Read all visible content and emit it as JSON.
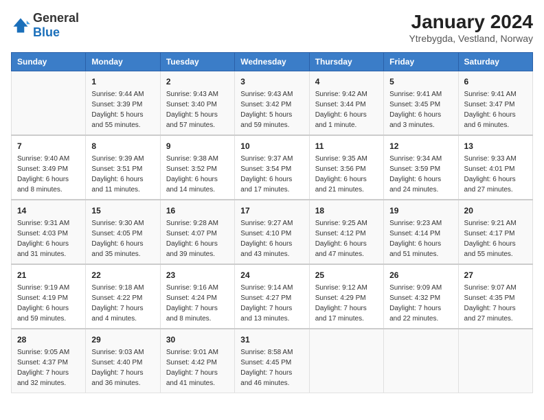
{
  "logo": {
    "general": "General",
    "blue": "Blue"
  },
  "title": "January 2024",
  "subtitle": "Ytrebygda, Vestland, Norway",
  "days_header": [
    "Sunday",
    "Monday",
    "Tuesday",
    "Wednesday",
    "Thursday",
    "Friday",
    "Saturday"
  ],
  "weeks": [
    [
      {
        "num": "",
        "sunrise": "",
        "sunset": "",
        "daylight": ""
      },
      {
        "num": "1",
        "sunrise": "Sunrise: 9:44 AM",
        "sunset": "Sunset: 3:39 PM",
        "daylight": "Daylight: 5 hours and 55 minutes."
      },
      {
        "num": "2",
        "sunrise": "Sunrise: 9:43 AM",
        "sunset": "Sunset: 3:40 PM",
        "daylight": "Daylight: 5 hours and 57 minutes."
      },
      {
        "num": "3",
        "sunrise": "Sunrise: 9:43 AM",
        "sunset": "Sunset: 3:42 PM",
        "daylight": "Daylight: 5 hours and 59 minutes."
      },
      {
        "num": "4",
        "sunrise": "Sunrise: 9:42 AM",
        "sunset": "Sunset: 3:44 PM",
        "daylight": "Daylight: 6 hours and 1 minute."
      },
      {
        "num": "5",
        "sunrise": "Sunrise: 9:41 AM",
        "sunset": "Sunset: 3:45 PM",
        "daylight": "Daylight: 6 hours and 3 minutes."
      },
      {
        "num": "6",
        "sunrise": "Sunrise: 9:41 AM",
        "sunset": "Sunset: 3:47 PM",
        "daylight": "Daylight: 6 hours and 6 minutes."
      }
    ],
    [
      {
        "num": "7",
        "sunrise": "Sunrise: 9:40 AM",
        "sunset": "Sunset: 3:49 PM",
        "daylight": "Daylight: 6 hours and 8 minutes."
      },
      {
        "num": "8",
        "sunrise": "Sunrise: 9:39 AM",
        "sunset": "Sunset: 3:51 PM",
        "daylight": "Daylight: 6 hours and 11 minutes."
      },
      {
        "num": "9",
        "sunrise": "Sunrise: 9:38 AM",
        "sunset": "Sunset: 3:52 PM",
        "daylight": "Daylight: 6 hours and 14 minutes."
      },
      {
        "num": "10",
        "sunrise": "Sunrise: 9:37 AM",
        "sunset": "Sunset: 3:54 PM",
        "daylight": "Daylight: 6 hours and 17 minutes."
      },
      {
        "num": "11",
        "sunrise": "Sunrise: 9:35 AM",
        "sunset": "Sunset: 3:56 PM",
        "daylight": "Daylight: 6 hours and 21 minutes."
      },
      {
        "num": "12",
        "sunrise": "Sunrise: 9:34 AM",
        "sunset": "Sunset: 3:59 PM",
        "daylight": "Daylight: 6 hours and 24 minutes."
      },
      {
        "num": "13",
        "sunrise": "Sunrise: 9:33 AM",
        "sunset": "Sunset: 4:01 PM",
        "daylight": "Daylight: 6 hours and 27 minutes."
      }
    ],
    [
      {
        "num": "14",
        "sunrise": "Sunrise: 9:31 AM",
        "sunset": "Sunset: 4:03 PM",
        "daylight": "Daylight: 6 hours and 31 minutes."
      },
      {
        "num": "15",
        "sunrise": "Sunrise: 9:30 AM",
        "sunset": "Sunset: 4:05 PM",
        "daylight": "Daylight: 6 hours and 35 minutes."
      },
      {
        "num": "16",
        "sunrise": "Sunrise: 9:28 AM",
        "sunset": "Sunset: 4:07 PM",
        "daylight": "Daylight: 6 hours and 39 minutes."
      },
      {
        "num": "17",
        "sunrise": "Sunrise: 9:27 AM",
        "sunset": "Sunset: 4:10 PM",
        "daylight": "Daylight: 6 hours and 43 minutes."
      },
      {
        "num": "18",
        "sunrise": "Sunrise: 9:25 AM",
        "sunset": "Sunset: 4:12 PM",
        "daylight": "Daylight: 6 hours and 47 minutes."
      },
      {
        "num": "19",
        "sunrise": "Sunrise: 9:23 AM",
        "sunset": "Sunset: 4:14 PM",
        "daylight": "Daylight: 6 hours and 51 minutes."
      },
      {
        "num": "20",
        "sunrise": "Sunrise: 9:21 AM",
        "sunset": "Sunset: 4:17 PM",
        "daylight": "Daylight: 6 hours and 55 minutes."
      }
    ],
    [
      {
        "num": "21",
        "sunrise": "Sunrise: 9:19 AM",
        "sunset": "Sunset: 4:19 PM",
        "daylight": "Daylight: 6 hours and 59 minutes."
      },
      {
        "num": "22",
        "sunrise": "Sunrise: 9:18 AM",
        "sunset": "Sunset: 4:22 PM",
        "daylight": "Daylight: 7 hours and 4 minutes."
      },
      {
        "num": "23",
        "sunrise": "Sunrise: 9:16 AM",
        "sunset": "Sunset: 4:24 PM",
        "daylight": "Daylight: 7 hours and 8 minutes."
      },
      {
        "num": "24",
        "sunrise": "Sunrise: 9:14 AM",
        "sunset": "Sunset: 4:27 PM",
        "daylight": "Daylight: 7 hours and 13 minutes."
      },
      {
        "num": "25",
        "sunrise": "Sunrise: 9:12 AM",
        "sunset": "Sunset: 4:29 PM",
        "daylight": "Daylight: 7 hours and 17 minutes."
      },
      {
        "num": "26",
        "sunrise": "Sunrise: 9:09 AM",
        "sunset": "Sunset: 4:32 PM",
        "daylight": "Daylight: 7 hours and 22 minutes."
      },
      {
        "num": "27",
        "sunrise": "Sunrise: 9:07 AM",
        "sunset": "Sunset: 4:35 PM",
        "daylight": "Daylight: 7 hours and 27 minutes."
      }
    ],
    [
      {
        "num": "28",
        "sunrise": "Sunrise: 9:05 AM",
        "sunset": "Sunset: 4:37 PM",
        "daylight": "Daylight: 7 hours and 32 minutes."
      },
      {
        "num": "29",
        "sunrise": "Sunrise: 9:03 AM",
        "sunset": "Sunset: 4:40 PM",
        "daylight": "Daylight: 7 hours and 36 minutes."
      },
      {
        "num": "30",
        "sunrise": "Sunrise: 9:01 AM",
        "sunset": "Sunset: 4:42 PM",
        "daylight": "Daylight: 7 hours and 41 minutes."
      },
      {
        "num": "31",
        "sunrise": "Sunrise: 8:58 AM",
        "sunset": "Sunset: 4:45 PM",
        "daylight": "Daylight: 7 hours and 46 minutes."
      },
      {
        "num": "",
        "sunrise": "",
        "sunset": "",
        "daylight": ""
      },
      {
        "num": "",
        "sunrise": "",
        "sunset": "",
        "daylight": ""
      },
      {
        "num": "",
        "sunrise": "",
        "sunset": "",
        "daylight": ""
      }
    ]
  ]
}
